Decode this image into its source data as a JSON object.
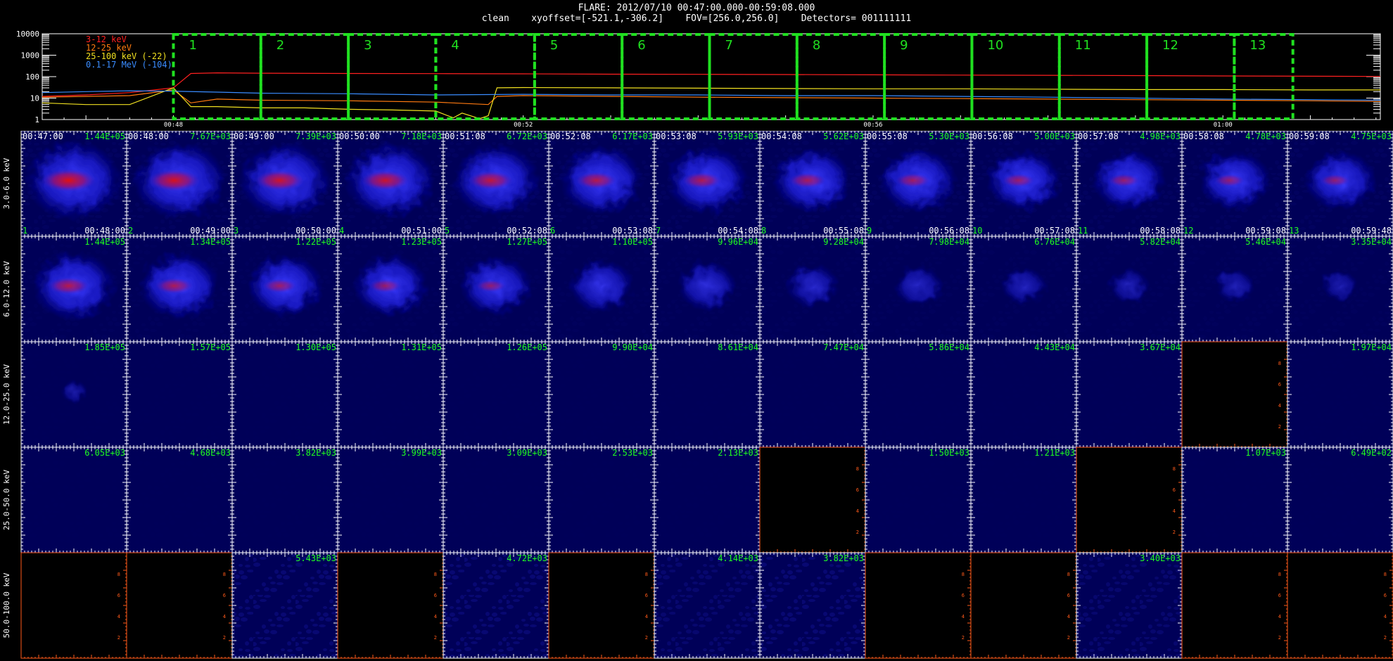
{
  "header": {
    "title": "FLARE: 2012/07/10 00:47:00.000-00:59:08.000",
    "subtitle": "clean    xyoffset=[-521.1,-306.2]    FOV=[256.0,256.0]    Detectors= 001111111"
  },
  "colors": {
    "background": "#000000",
    "red": "#ff2020",
    "orange": "#ff7a10",
    "yellow": "#f0e020",
    "blue": "#3a8cff",
    "interval_box": "#20e020",
    "timestamp": "#ffffff",
    "value_label": "#20ff20",
    "empty_axis": "#ff5a1a"
  },
  "chart_data": [
    {
      "type": "line",
      "name": "lightcurve",
      "yscale": "log",
      "ylim": [
        1,
        10000
      ],
      "yticks": [
        "1",
        "10",
        "100",
        "1000",
        "10000"
      ],
      "xlim_minutes": [
        46.5,
        61.8
      ],
      "xticks": [
        {
          "t": 48,
          "label": "00:48"
        },
        {
          "t": 52,
          "label": "00:52"
        },
        {
          "t": 56,
          "label": "00:56"
        },
        {
          "t": 60,
          "label": "01:00"
        }
      ],
      "series": [
        {
          "name": "3-12 keV",
          "color": "#ff2020",
          "t": [
            46.5,
            47.0,
            47.5,
            48.0,
            48.2,
            48.5,
            49.0,
            50.0,
            51.0,
            52.0,
            53.0,
            54.0,
            55.0,
            56.0,
            57.0,
            58.0,
            59.0,
            60.0,
            61.0,
            61.8
          ],
          "v": [
            12,
            14,
            18,
            30,
            140,
            150,
            145,
            140,
            138,
            135,
            130,
            128,
            125,
            122,
            118,
            115,
            112,
            108,
            105,
            102
          ]
        },
        {
          "name": "12-25 keV",
          "color": "#ff7a10",
          "t": [
            46.5,
            47.0,
            47.5,
            48.0,
            48.2,
            48.5,
            49.0,
            50.0,
            51.0,
            51.6,
            51.7,
            52.0,
            53.0,
            54.0,
            55.0,
            56.0,
            57.0,
            58.0,
            59.0,
            60.0,
            61.0,
            61.8
          ],
          "v": [
            11,
            12,
            13,
            24,
            6,
            9,
            8,
            7.5,
            6.5,
            5,
            12,
            13,
            12,
            11,
            10.5,
            10,
            9.5,
            9,
            8.5,
            8,
            7.5,
            7
          ]
        },
        {
          "name": "25-100 keV (-22)",
          "color": "#f0e020",
          "t": [
            46.5,
            47.0,
            47.5,
            48.0,
            48.2,
            48.5,
            49.0,
            49.5,
            50.0,
            50.5,
            51.0,
            51.2,
            51.3,
            51.5,
            51.6,
            51.7,
            52.0,
            53.0,
            54.0,
            55.0,
            56.0,
            57.0,
            58.0,
            59.0,
            60.0,
            61.0,
            61.8
          ],
          "v": [
            6,
            5,
            5,
            30,
            4,
            4,
            3.5,
            3.5,
            3,
            2.8,
            2.5,
            1.2,
            2,
            1.1,
            1.5,
            30,
            31,
            30,
            29,
            28,
            27,
            27,
            26,
            25,
            25,
            24,
            24
          ]
        },
        {
          "name": "0.1-17 MeV (-104)",
          "color": "#3a8cff",
          "t": [
            46.5,
            47.0,
            47.5,
            48.0,
            48.5,
            49.0,
            50.0,
            51.0,
            52.0,
            53.0,
            54.0,
            55.0,
            56.0,
            57.0,
            58.0,
            59.0,
            60.0,
            61.0,
            61.8
          ],
          "v": [
            18,
            20,
            22,
            21,
            19,
            17,
            16,
            14,
            15,
            14,
            14,
            13,
            13,
            12,
            11,
            10,
            9,
            8.5,
            8
          ]
        }
      ],
      "intervals": [
        {
          "label": "1",
          "t0": 48.0,
          "t1": 49.0
        },
        {
          "label": "2",
          "t0": 49.0,
          "t1": 50.0
        },
        {
          "label": "3",
          "t0": 50.0,
          "t1": 51.0
        },
        {
          "label": "4",
          "t0": 51.0,
          "t1": 52.13
        },
        {
          "label": "5",
          "t0": 52.13,
          "t1": 53.13
        },
        {
          "label": "6",
          "t0": 53.13,
          "t1": 54.13
        },
        {
          "label": "7",
          "t0": 54.13,
          "t1": 55.13
        },
        {
          "label": "8",
          "t0": 55.13,
          "t1": 56.13
        },
        {
          "label": "9",
          "t0": 56.13,
          "t1": 57.13
        },
        {
          "label": "10",
          "t0": 57.13,
          "t1": 58.13
        },
        {
          "label": "11",
          "t0": 58.13,
          "t1": 59.13
        },
        {
          "label": "12",
          "t0": 59.13,
          "t1": 60.13
        },
        {
          "label": "13",
          "t0": 60.13,
          "t1": 60.8
        }
      ]
    },
    {
      "type": "heatmap",
      "name": "image-grid",
      "energy_bands": [
        "3.0-6.0 keV",
        "6.0-12.0 keV",
        "12.0-25.0 keV",
        "25.0-50.0 keV",
        "50.0-100.0 keV"
      ],
      "start_times": [
        "00:47:00",
        "00:48:00",
        "00:49:00",
        "00:50:00",
        "00:51:08",
        "00:52:08",
        "00:53:08",
        "00:54:08",
        "00:55:08",
        "00:56:08",
        "00:57:08",
        "00:58:08",
        "00:59:08"
      ],
      "end_times": [
        "00:48:00",
        "00:49:00",
        "00:50:00",
        "00:51:00",
        "00:52:08",
        "00:53:08",
        "00:54:08",
        "00:55:08",
        "00:56:08",
        "00:57:08",
        "00:58:08",
        "00:59:08",
        "00:59:48"
      ],
      "indices": [
        "1",
        "2",
        "3",
        "4",
        "5",
        "6",
        "7",
        "8",
        "9",
        "10",
        "11",
        "12",
        "13"
      ],
      "values": [
        [
          "1.44E+05",
          "7.67E+03",
          "7.39E+03",
          "7.18E+03",
          "6.72E+03",
          "6.17E+03",
          "5.93E+03",
          "5.62E+03",
          "5.30E+03",
          "5.00E+03",
          "4.98E+03",
          "4.78E+03",
          "4.75E+03"
        ],
        [
          "1.44E+05",
          "1.34E+05",
          "1.22E+05",
          "1.23E+05",
          "1.27E+05",
          "1.10E+05",
          "9.96E+04",
          "9.28E+04",
          "7.98E+04",
          "6.76E+04",
          "5.82E+04",
          "5.46E+04",
          "3.35E+04"
        ],
        [
          "1.85E+05",
          "1.57E+05",
          "1.30E+05",
          "1.31E+05",
          "1.26E+05",
          "9.90E+04",
          "8.61E+04",
          "7.47E+04",
          "5.86E+04",
          "4.43E+04",
          "3.67E+04",
          "",
          "1.97E+04"
        ],
        [
          "6.05E+03",
          "4.68E+03",
          "3.82E+03",
          "3.99E+03",
          "3.09E+03",
          "2.53E+03",
          "2.13E+03",
          "",
          "1.50E+03",
          "1.21E+03",
          "",
          "1.07E+03",
          "6.49E+02"
        ],
        [
          "",
          "",
          "5.43E+03",
          "",
          "4.72E+03",
          "",
          "4.14E+03",
          "3.82E+03",
          "",
          "",
          "3.40E+03",
          "",
          ""
        ]
      ],
      "empty_axis_ticks": [
        "2",
        "4",
        "6",
        "8"
      ],
      "source_intensity": [
        [
          1.0,
          0.95,
          0.9,
          0.88,
          0.82,
          0.75,
          0.72,
          0.68,
          0.64,
          0.6,
          0.58,
          0.56,
          0.55
        ],
        [
          0.75,
          0.7,
          0.62,
          0.6,
          0.55,
          0.45,
          0.38,
          0.3,
          0.26,
          0.22,
          0.18,
          0.17,
          0.14
        ],
        [
          0.08,
          0,
          0,
          0,
          0,
          0,
          0,
          0,
          0,
          0,
          0,
          0,
          0
        ],
        [
          0,
          0,
          0,
          0,
          0,
          0,
          0,
          0,
          0,
          0,
          0,
          0,
          0
        ],
        [
          0,
          0,
          0,
          0,
          0,
          0,
          0,
          0,
          0,
          0,
          0,
          0,
          0
        ]
      ],
      "noise_level": [
        [
          0.1,
          0.1,
          0.1,
          0.1,
          0.1,
          0.1,
          0.1,
          0.1,
          0.1,
          0.1,
          0.1,
          0.1,
          0.1
        ],
        [
          0.05,
          0.05,
          0.05,
          0.05,
          0.05,
          0.05,
          0.05,
          0.05,
          0.05,
          0.05,
          0.05,
          0.05,
          0.05
        ],
        [
          0.02,
          0.02,
          0.02,
          0.02,
          0.02,
          0.02,
          0.02,
          0.02,
          0.02,
          0.02,
          0.02,
          0,
          0.02
        ],
        [
          0.02,
          0.02,
          0.02,
          0.02,
          0.02,
          0.02,
          0.02,
          0,
          0.02,
          0.02,
          0,
          0.02,
          0.02
        ],
        [
          0,
          0,
          0.35,
          0,
          0.35,
          0,
          0.3,
          0.35,
          0,
          0,
          0.3,
          0,
          0
        ]
      ]
    }
  ]
}
